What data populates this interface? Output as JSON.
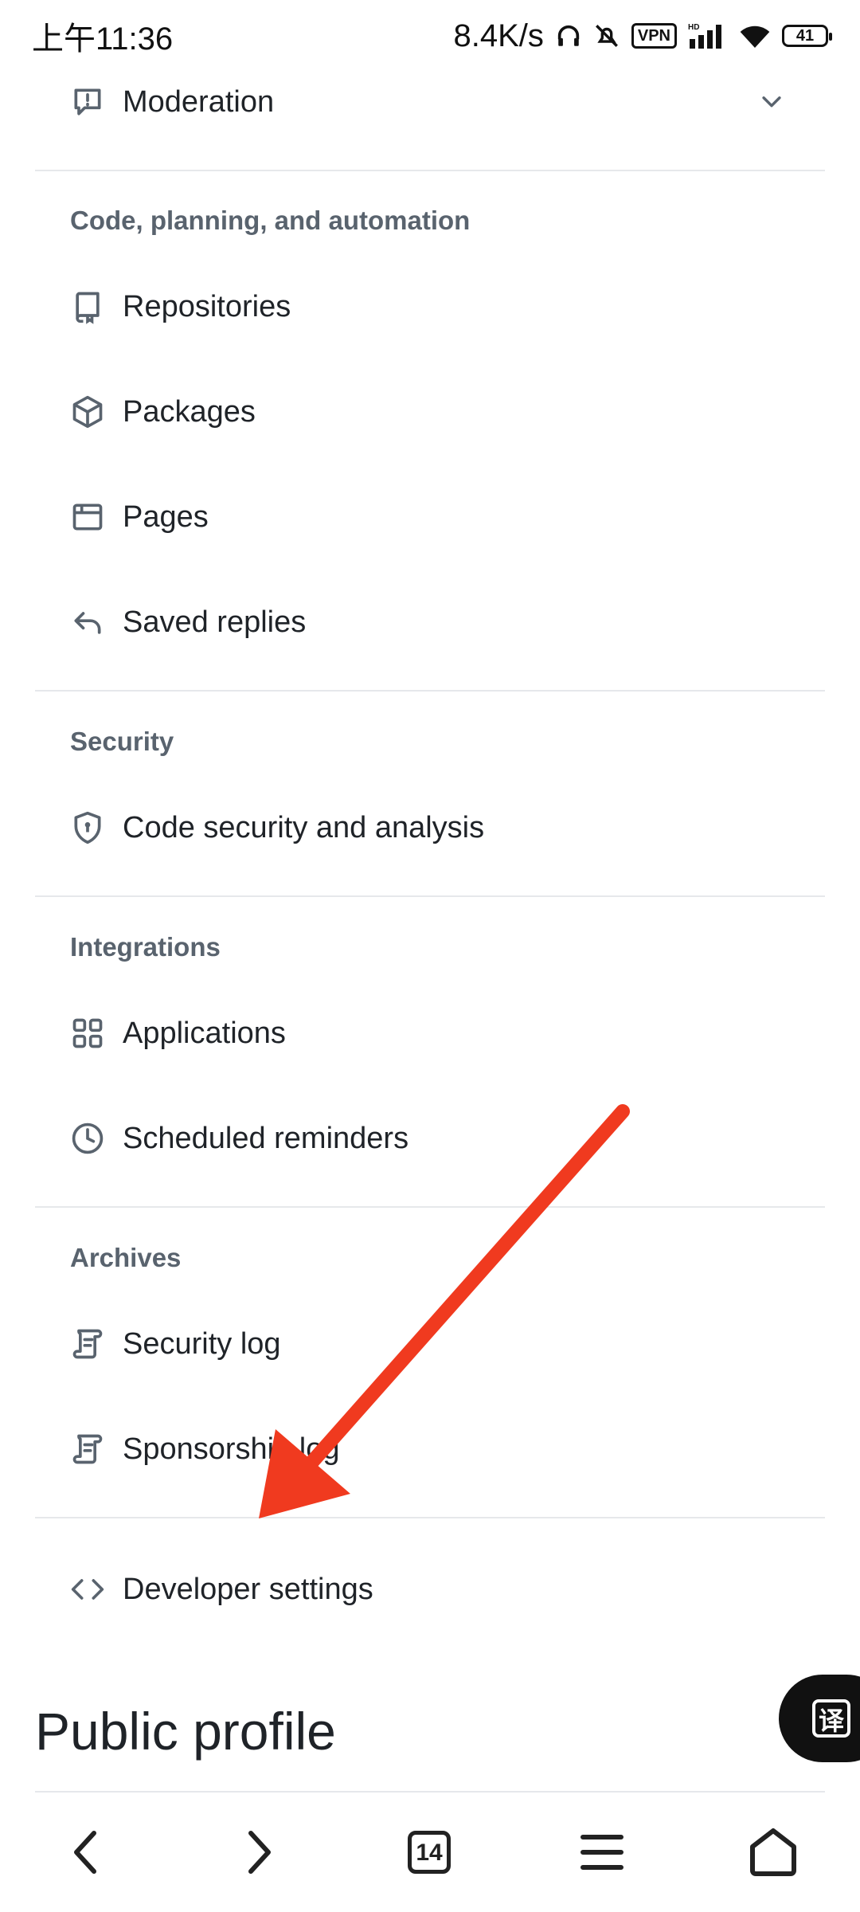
{
  "status_bar": {
    "time": "上午11:36",
    "net_speed": "8.4K/s",
    "vpn": "VPN",
    "hd": "HD",
    "battery": "41"
  },
  "menu": {
    "moderation": "Moderation",
    "sections": {
      "code": "Code, planning, and automation",
      "security": "Security",
      "integrations": "Integrations",
      "archives": "Archives"
    },
    "items": {
      "repositories": "Repositories",
      "packages": "Packages",
      "pages": "Pages",
      "saved_replies": "Saved replies",
      "code_security": "Code security and analysis",
      "applications": "Applications",
      "scheduled_reminders": "Scheduled reminders",
      "security_log": "Security log",
      "sponsorship_log": "Sponsorship log",
      "developer_settings": "Developer settings"
    }
  },
  "public_profile": "Public profile",
  "translate_fab": "译",
  "bottom_nav": {
    "tab_count": "14"
  },
  "annotation": {
    "arrow_color": "#f03a1f"
  }
}
